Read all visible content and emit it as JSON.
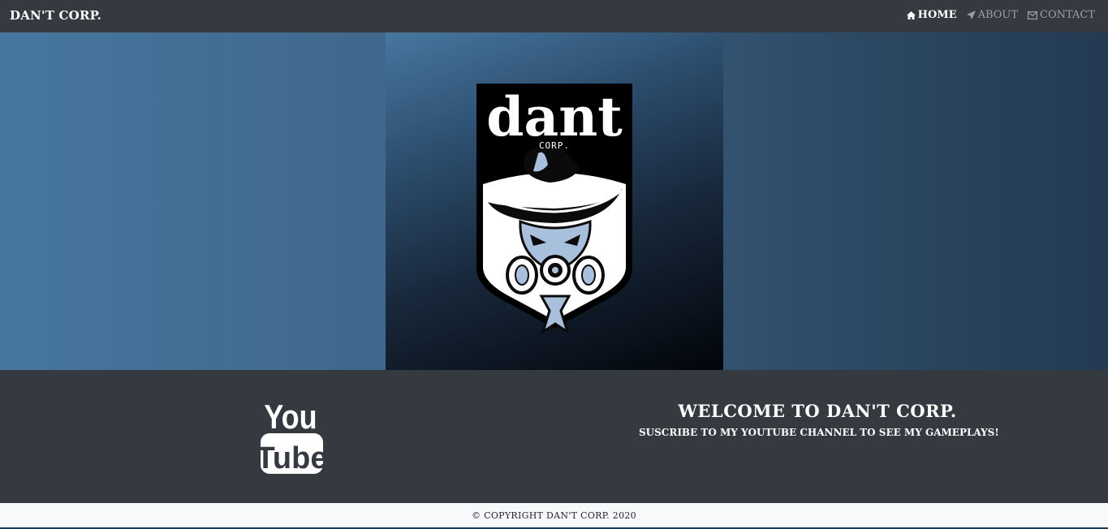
{
  "navbar": {
    "brand": "DAN'T CORP.",
    "links": [
      {
        "label": "HOME",
        "icon": "home-icon",
        "active": true
      },
      {
        "label": "ABOUT",
        "icon": "rocket-icon",
        "active": false
      },
      {
        "label": "CONTACT",
        "icon": "envelope-icon",
        "active": false
      }
    ]
  },
  "hero": {
    "logo": {
      "wordmark": "dant",
      "submark": "CORP."
    }
  },
  "welcome": {
    "youtube_logo": {
      "line1": "You",
      "line2": "Tube"
    },
    "title": "WELCOME TO DAN'T CORP.",
    "subtitle": "SUSCRIBE TO MY YOUTUBE CHANNEL TO SEE MY GAMEPLAYS!"
  },
  "footer": {
    "copyright": "© COPYRIGHT DAN'T CORP. 2020"
  },
  "colors": {
    "navbar_bg": "#343a40",
    "hero_left": "#47779f",
    "hero_right": "#233a52",
    "footer_bg": "#f8f9fa",
    "logo_light": "#a9c0dc"
  }
}
